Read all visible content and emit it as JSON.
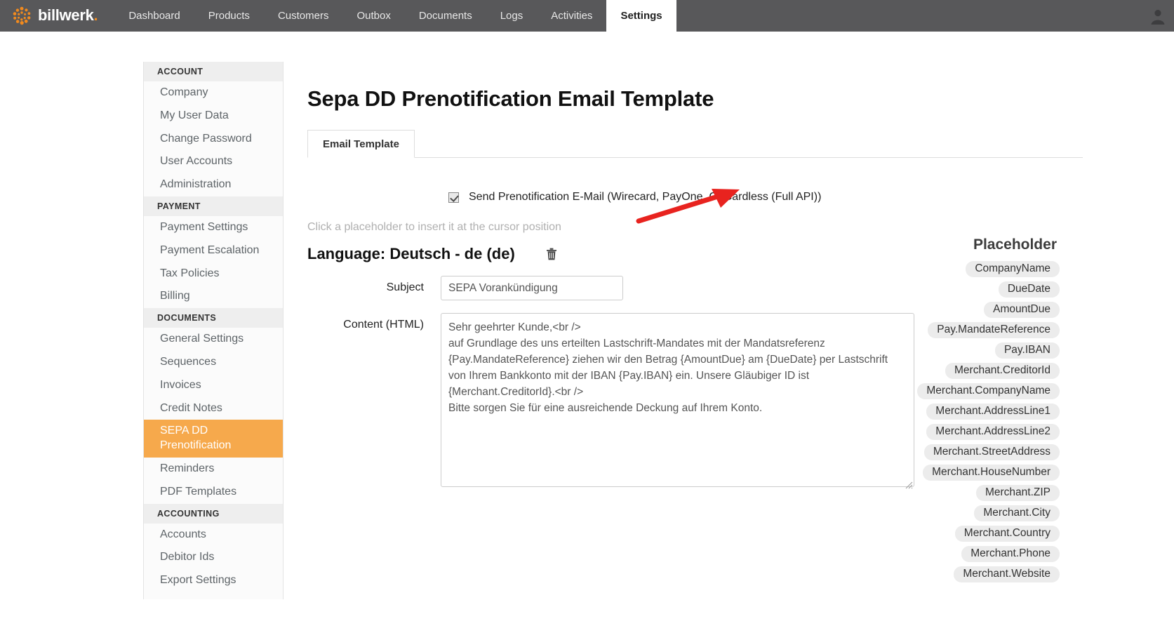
{
  "brand": {
    "logo_text": "billwerk",
    "logo_dot": ".",
    "accent_orange": "#f18a1e",
    "nav_bg": "#58585a",
    "active_item_bg": "#f6a94c",
    "annotation_color": "#e8231f"
  },
  "topnav": {
    "items": [
      {
        "label": "Dashboard",
        "active": false
      },
      {
        "label": "Products",
        "active": false
      },
      {
        "label": "Customers",
        "active": false
      },
      {
        "label": "Outbox",
        "active": false
      },
      {
        "label": "Documents",
        "active": false
      },
      {
        "label": "Logs",
        "active": false
      },
      {
        "label": "Activities",
        "active": false
      },
      {
        "label": "Settings",
        "active": true
      }
    ],
    "avatar_icon": "user-avatar-icon"
  },
  "sidebar": {
    "groups": [
      {
        "title": "ACCOUNT",
        "items": [
          {
            "label": "Company",
            "active": false
          },
          {
            "label": "My User Data",
            "active": false
          },
          {
            "label": "Change Password",
            "active": false
          },
          {
            "label": "User Accounts",
            "active": false
          },
          {
            "label": "Administration",
            "active": false
          }
        ]
      },
      {
        "title": "PAYMENT",
        "items": [
          {
            "label": "Payment Settings",
            "active": false
          },
          {
            "label": "Payment Escalation",
            "active": false
          },
          {
            "label": "Tax Policies",
            "active": false
          },
          {
            "label": "Billing",
            "active": false
          }
        ]
      },
      {
        "title": "DOCUMENTS",
        "items": [
          {
            "label": "General Settings",
            "active": false
          },
          {
            "label": "Sequences",
            "active": false
          },
          {
            "label": "Invoices",
            "active": false
          },
          {
            "label": "Credit Notes",
            "active": false
          },
          {
            "label": "SEPA DD Prenotification",
            "active": true
          },
          {
            "label": "Reminders",
            "active": false
          },
          {
            "label": "PDF Templates",
            "active": false
          }
        ]
      },
      {
        "title": "ACCOUNTING",
        "items": [
          {
            "label": "Accounts",
            "active": false
          },
          {
            "label": "Debitor Ids",
            "active": false
          },
          {
            "label": "Export Settings",
            "active": false
          }
        ]
      }
    ]
  },
  "main": {
    "page_title": "Sepa DD Prenotification Email Template",
    "tabs": [
      {
        "label": "Email Template",
        "active": true
      }
    ],
    "send_checkbox": {
      "label": "Send Prenotification E-Mail (Wirecard, PayOne, GoCardless (Full API))",
      "checked": true
    },
    "hint": "Click a placeholder to insert it at the cursor position",
    "language_heading": "Language: Deutsch - de (de)",
    "delete_icon": "trash-icon",
    "subject": {
      "label": "Subject",
      "value": "SEPA Vorankündigung"
    },
    "content": {
      "label": "Content (HTML)",
      "value": "Sehr geehrter Kunde,<br />\nauf Grundlage des uns erteilten Lastschrift-Mandates mit der Mandatsreferenz {Pay.MandateReference} ziehen wir den Betrag {AmountDue} am {DueDate} per Lastschrift von Ihrem Bankkonto mit der IBAN {Pay.IBAN} ein. Unsere Gläubiger ID ist {Merchant.CreditorId}.<br />\nBitte sorgen Sie für eine ausreichende Deckung auf Ihrem Konto."
    }
  },
  "placeholders": {
    "title": "Placeholder",
    "items": [
      "CompanyName",
      "DueDate",
      "AmountDue",
      "Pay.MandateReference",
      "Pay.IBAN",
      "Merchant.CreditorId",
      "Merchant.CompanyName",
      "Merchant.AddressLine1",
      "Merchant.AddressLine2",
      "Merchant.StreetAddress",
      "Merchant.HouseNumber",
      "Merchant.ZIP",
      "Merchant.City",
      "Merchant.Country",
      "Merchant.Phone",
      "Merchant.Website"
    ]
  }
}
